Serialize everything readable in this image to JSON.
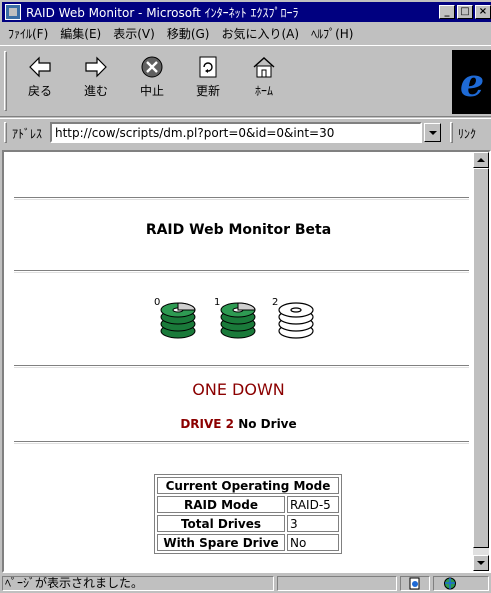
{
  "window": {
    "title": "RAID Web Monitor - Microsoft ｲﾝﾀｰﾈｯﾄ ｴｸｽﾌﾟﾛｰﾗ"
  },
  "menu": [
    "ﾌｧｲﾙ(F)",
    "編集(E)",
    "表示(V)",
    "移動(G)",
    "お気に入り(A)",
    "ﾍﾙﾌﾟ(H)"
  ],
  "toolbar": {
    "back": "戻る",
    "forward": "進む",
    "stop": "中止",
    "refresh": "更新",
    "home": "ﾎｰﾑ"
  },
  "address": {
    "label": "ｱﾄﾞﾚｽ",
    "url": "http://cow/scripts/dm.pl?port=0&id=0&int=30",
    "links_label": "ﾘﾝｸ"
  },
  "page": {
    "title": "RAID Web Monitor Beta",
    "drives": [
      {
        "number": "0",
        "state": "online",
        "icon": "disk-stack-online-icon"
      },
      {
        "number": "1",
        "state": "online",
        "icon": "disk-stack-online-icon"
      },
      {
        "number": "2",
        "state": "empty",
        "icon": "disk-stack-empty-icon"
      }
    ],
    "status_title": "ONE DOWN",
    "status_drive": "DRIVE 2",
    "status_detail": "No Drive",
    "mode_table": {
      "header": "Current Operating Mode",
      "rows": [
        {
          "key": "RAID Mode",
          "value": "RAID-5"
        },
        {
          "key": "Total Drives",
          "value": "3"
        },
        {
          "key": "With Spare Drive",
          "value": "No"
        }
      ]
    }
  },
  "statusbar": {
    "text": "ﾍﾟｰｼﾞが表示されました。"
  },
  "colors": {
    "titlebar": "#000080",
    "status_red": "#8b0000",
    "disk_green": "#1a7a3a"
  }
}
